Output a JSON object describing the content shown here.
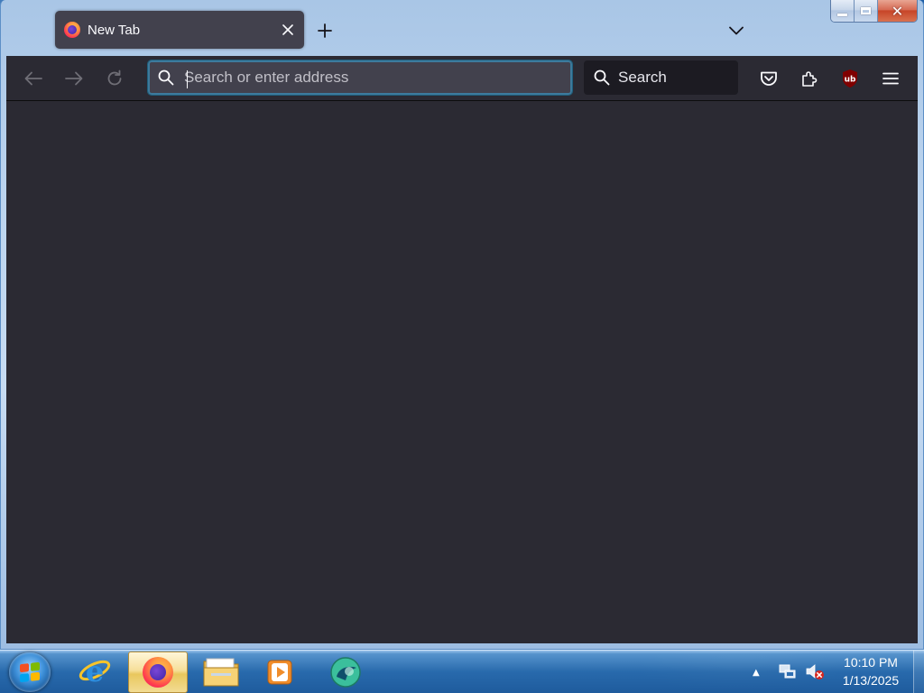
{
  "window": {
    "caption": {
      "minimize_label": "Minimize",
      "maximize_label": "Maximize",
      "close_label": "Close"
    }
  },
  "tabs": [
    {
      "title": "New Tab",
      "favicon": "firefox-icon",
      "active": true
    }
  ],
  "tabstrip": {
    "new_tab_icon": "plus-icon",
    "list_all_tabs_icon": "chevron-down-icon"
  },
  "navbar": {
    "back_icon": "arrow-left-icon",
    "forward_icon": "arrow-right-icon",
    "reload_icon": "reload-icon",
    "urlbar": {
      "value": "",
      "placeholder": "Search or enter address"
    },
    "searchbar": {
      "value": "",
      "placeholder": "Search"
    },
    "toolbar_icons": [
      "pocket-icon",
      "extensions-icon",
      "ublock-origin-icon",
      "hamburger-menu-icon"
    ]
  },
  "taskbar": {
    "pinned": [
      {
        "name": "internet-explorer-icon"
      },
      {
        "name": "firefox-icon",
        "active": true
      },
      {
        "name": "file-explorer-icon"
      },
      {
        "name": "media-player-icon"
      },
      {
        "name": "chat-app-icon"
      }
    ],
    "tray": {
      "icons": [
        "network-icon",
        "volume-muted-icon"
      ]
    },
    "clock": {
      "time": "10:10 PM",
      "date": "1/13/2025"
    }
  },
  "colors": {
    "toolbar_bg": "#2b2a33",
    "tab_bg": "#42414d",
    "urlbar_focus_border": "#3d7a9c",
    "content_bg": "#2b2a33",
    "text": "#fbfbfe"
  }
}
